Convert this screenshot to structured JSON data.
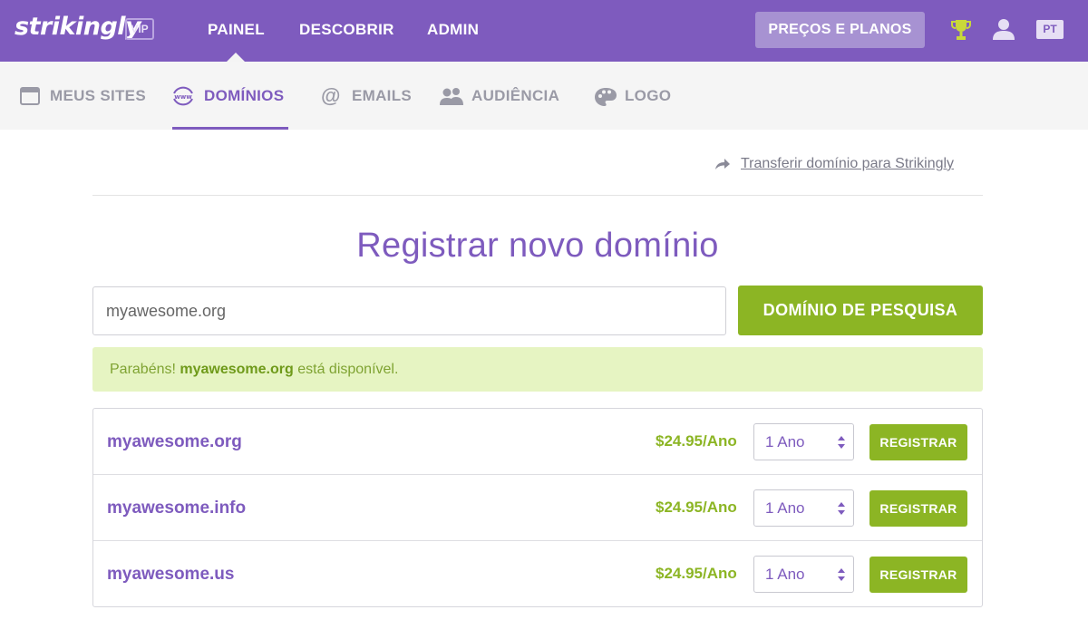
{
  "brand": {
    "logo": "strikingly",
    "badge": "VIP"
  },
  "topnav": {
    "items": [
      "PAINEL",
      "DESCOBRIR",
      "ADMIN"
    ],
    "pricing_button": "PREÇOS E PLANOS",
    "language": "PT"
  },
  "subnav": {
    "items": [
      {
        "label": "MEUS SITES",
        "icon": "browser-window-icon"
      },
      {
        "label": "DOMÍNIOS",
        "icon": "www-globe-icon"
      },
      {
        "label": "EMAILS",
        "icon": "at-sign-icon"
      },
      {
        "label": "AUDIÊNCIA",
        "icon": "people-icon"
      },
      {
        "label": "LOGO",
        "icon": "palette-icon"
      }
    ],
    "active": "DOMÍNIOS"
  },
  "transfer_link": "Transferir domínio para Strikingly",
  "page_title": "Registrar novo domínio",
  "search": {
    "value": "myawesome.org",
    "button": "DOMÍNIO DE PESQUISA"
  },
  "alert": {
    "prefix": "Parabéns!",
    "domain": "myawesome.org",
    "suffix": "está disponível."
  },
  "results": [
    {
      "domain": "myawesome.org",
      "price": "$24.95/Ano",
      "period": "1 Ano",
      "button": "REGISTRAR"
    },
    {
      "domain": "myawesome.info",
      "price": "$24.95/Ano",
      "period": "1 Ano",
      "button": "REGISTRAR"
    },
    {
      "domain": "myawesome.us",
      "price": "$24.95/Ano",
      "period": "1 Ano",
      "button": "REGISTRAR"
    }
  ],
  "colors": {
    "brand_purple": "#7e5bbe",
    "accent_green": "#8cb524",
    "alert_bg": "#e6f4c2"
  }
}
